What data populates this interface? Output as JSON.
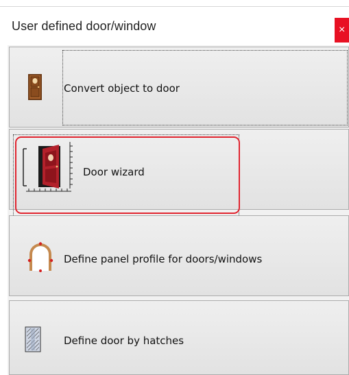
{
  "window": {
    "title": "User defined door/window",
    "close_glyph": "×"
  },
  "items": [
    {
      "label": "Convert object to door",
      "icon": "door-icon"
    },
    {
      "label": "Door wizard",
      "icon": "door-wizard-icon"
    },
    {
      "label": "Define panel profile for doors/windows",
      "icon": "arched-panel-icon"
    },
    {
      "label": "Define door by hatches",
      "icon": "hatched-door-icon"
    }
  ],
  "colors": {
    "highlight": "#e0242f",
    "close_button": "#e81123",
    "door_brown": "#9a5a2a",
    "door_red": "#b3212b"
  }
}
